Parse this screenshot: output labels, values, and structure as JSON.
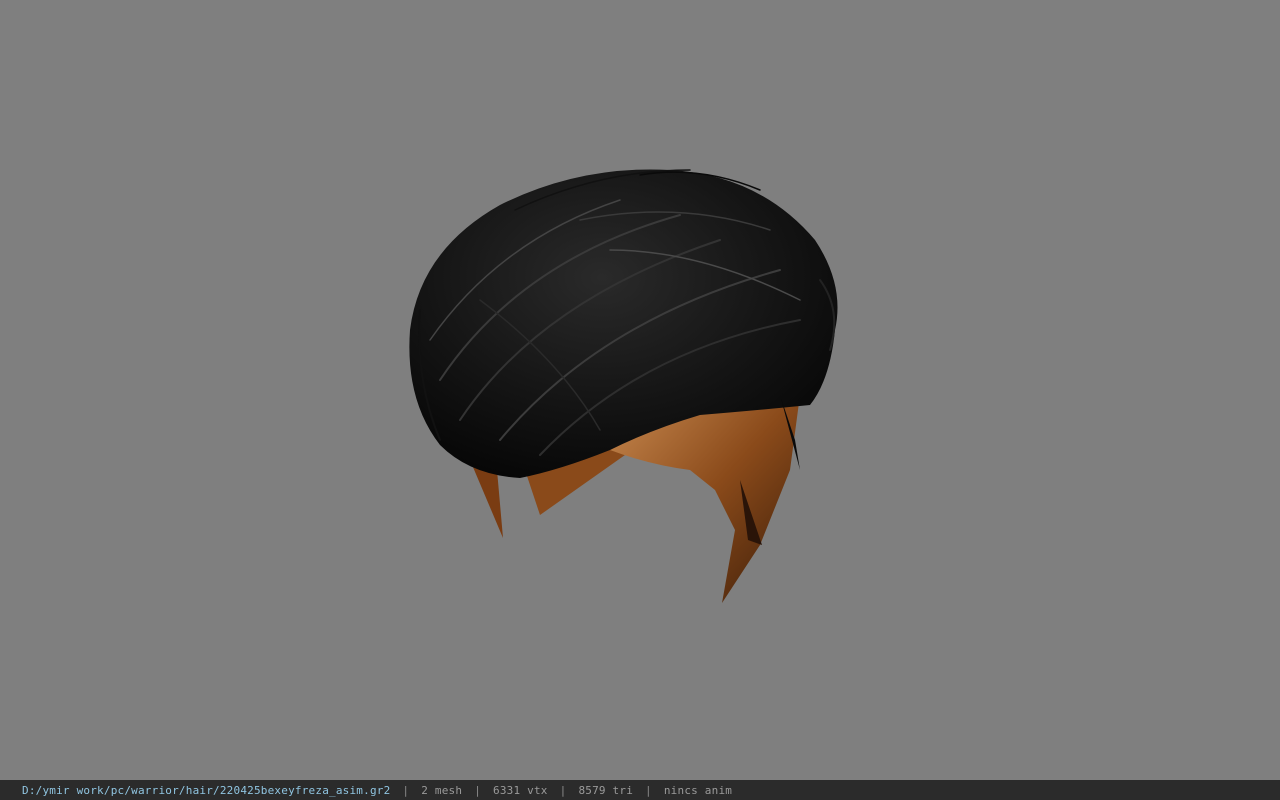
{
  "viewer": {
    "background_color": "#7f7f7f",
    "model_name": "hair-model",
    "hair_color": "#0d0d0d",
    "skin_color": "#8a4a1a"
  },
  "status": {
    "file_path": "D:/ymir work/pc/warrior/hair/220425bexeyfreza_asim.gr2",
    "separator": "|",
    "mesh": "2 mesh",
    "vertices": "6331 vtx",
    "triangles": "8579 tri",
    "animation": "nincs anim"
  }
}
